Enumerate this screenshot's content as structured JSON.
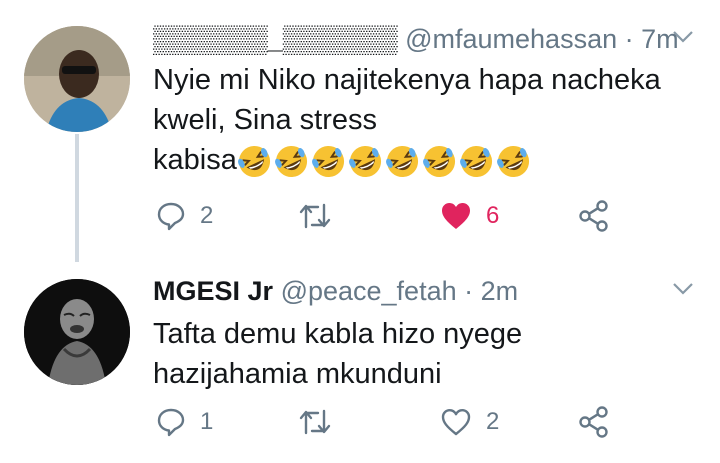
{
  "tweets": [
    {
      "name": "▒▒▒▒▒▒_▒▒▒▒▒▒",
      "handle": "@mfaumehassan",
      "separator": "·",
      "time": "7m",
      "text_line1": "Nyie mi Niko najitekenya hapa nacheka",
      "text_line2": "kweli, Sina stress",
      "text_line3": "kabisa",
      "emoji": "rolling-on-floor-laughing-emoji",
      "emoji_count": 8,
      "replies": "2",
      "retweets": "",
      "likes": "6",
      "liked": true
    },
    {
      "name": "MGESI Jr",
      "handle": "@peace_fetah",
      "separator": "·",
      "time": "2m",
      "text_line1": "Tafta demu kabla hizo nyege",
      "text_line2": "hazijahamia mkunduni",
      "replies": "1",
      "retweets": "",
      "likes": "2",
      "liked": false
    }
  ],
  "colors": {
    "text": "#14171a",
    "muted": "#657786",
    "like_red": "#e0245e",
    "thread_line": "#d0d8e0",
    "emoji_yellow": "#f7c232"
  }
}
